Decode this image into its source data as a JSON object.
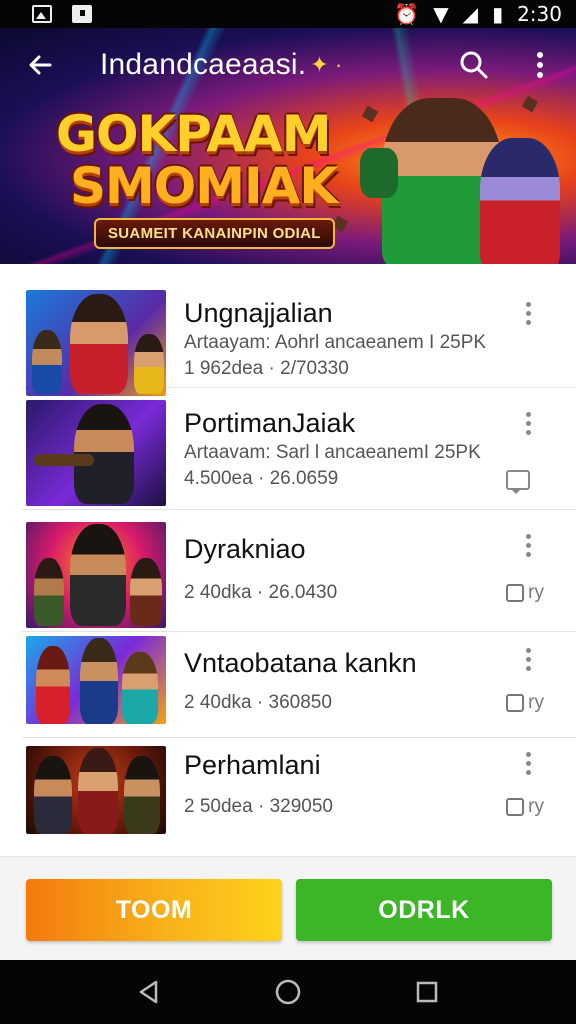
{
  "status_bar": {
    "time": "2:30"
  },
  "app_bar": {
    "title": "Indandcaeaasi."
  },
  "banner": {
    "logo_line1": "GOKPAAM",
    "logo_line2": "SMOMIAK",
    "ribbon": "SUAMEIT KANAINPIN ODIAL"
  },
  "list": {
    "items": [
      {
        "title": "Ungnajjalian",
        "subtitle": "Artaayam: Aohrl ancaeanem I 25PK",
        "meta": "1 962dea · 2/70330",
        "action": "none"
      },
      {
        "title": "PortimanJaiak",
        "subtitle": "Artaavam: Sarl l ancaeanemI 25PK",
        "meta": "4.500ea · 26.0659",
        "action": "chat"
      },
      {
        "title": "Dyrakniao",
        "subtitle": "",
        "meta": "2 40dka · 26.0430",
        "action": "check",
        "check_label": "ry"
      },
      {
        "title": "Vntaobatana kankn",
        "subtitle": "",
        "meta": "2 40dka · 360850",
        "action": "check",
        "check_label": "ry"
      },
      {
        "title": "Perhamlani",
        "subtitle": "",
        "meta": "2 50dea · 329050",
        "action": "check",
        "check_label": "ry"
      }
    ]
  },
  "actions": {
    "left_label": "TOOM",
    "right_label": "ODRLK"
  },
  "colors": {
    "left_button": "#f8b21a",
    "right_button": "#3cb526"
  }
}
